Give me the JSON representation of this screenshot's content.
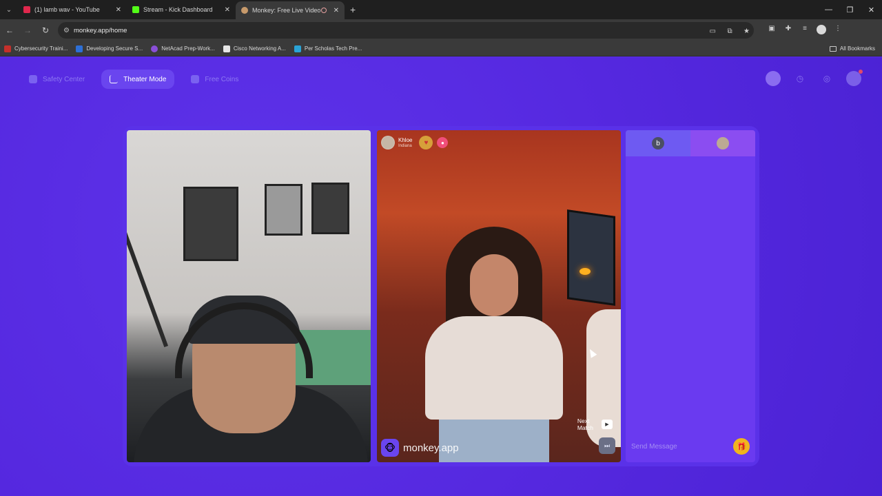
{
  "browser": {
    "tabs": [
      {
        "title": "(1) lamb wav - YouTube",
        "favicon_color": "#e0284d",
        "active": false
      },
      {
        "title": "Stream - Kick Dashboard",
        "favicon_color": "#53fc18",
        "active": false
      },
      {
        "title": "Monkey: Free Live Video Ch",
        "favicon_color": "#c79a6b",
        "active": true
      }
    ],
    "url": "monkey.app/home",
    "bookmarks": [
      {
        "label": "Cybersecurity Traini...",
        "color": "#c4302b"
      },
      {
        "label": "Developing Secure S...",
        "color": "#2d6fd6"
      },
      {
        "label": "NetAcad Prep-Work...",
        "color": "#8a4fd8"
      },
      {
        "label": "Cisco Networking A...",
        "color": "#e6e6e6"
      },
      {
        "label": "Per Scholas Tech Pre...",
        "color": "#2aa3d6"
      }
    ],
    "all_bookmarks": "All Bookmarks"
  },
  "nav": {
    "safety": "Safety Center",
    "theater": "Theater Mode",
    "coins": "Free Coins"
  },
  "partner": {
    "name": "Khloe",
    "location": "Indiana"
  },
  "video": {
    "watermark": "monkey.app",
    "next_match_line1": "Next",
    "next_match_line2": "Match"
  },
  "chat": {
    "tab_initial": "b",
    "placeholder": "Send Message"
  },
  "colors": {
    "page_bg": "#5528df",
    "accent": "#6a45ef",
    "gift": "#f0b51e"
  }
}
